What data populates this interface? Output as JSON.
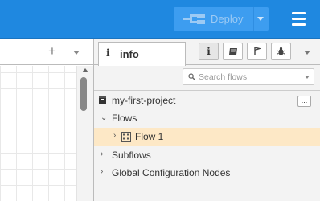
{
  "header": {
    "deploy_label": "Deploy",
    "colors": {
      "bar": "#1f88e0",
      "deploy_button": "#3d9df0"
    }
  },
  "workspace": {
    "add_icon": "plus-icon",
    "add_label": "+"
  },
  "sidebar": {
    "active_tab": {
      "icon": "info-icon",
      "icon_char": "i",
      "label": "info"
    },
    "tab_buttons": [
      {
        "name": "info-icon",
        "char": "i",
        "selected": true
      },
      {
        "name": "book-icon",
        "char": "",
        "selected": false
      },
      {
        "name": "flag-icon",
        "char": "",
        "selected": false
      },
      {
        "name": "bug-icon",
        "char": "",
        "selected": false
      }
    ],
    "search": {
      "placeholder": "Search flows"
    },
    "project": {
      "name": "my-first-project",
      "more_label": "..."
    },
    "tree": {
      "flows": {
        "label": "Flows",
        "expanded": true
      },
      "flow_items": [
        {
          "label": "Flow 1",
          "selected": true
        }
      ],
      "subflows": {
        "label": "Subflows",
        "expanded": false
      },
      "global_config": {
        "label": "Global Configuration Nodes",
        "expanded": false
      }
    },
    "colors": {
      "selected_row": "#fde8c6"
    }
  }
}
